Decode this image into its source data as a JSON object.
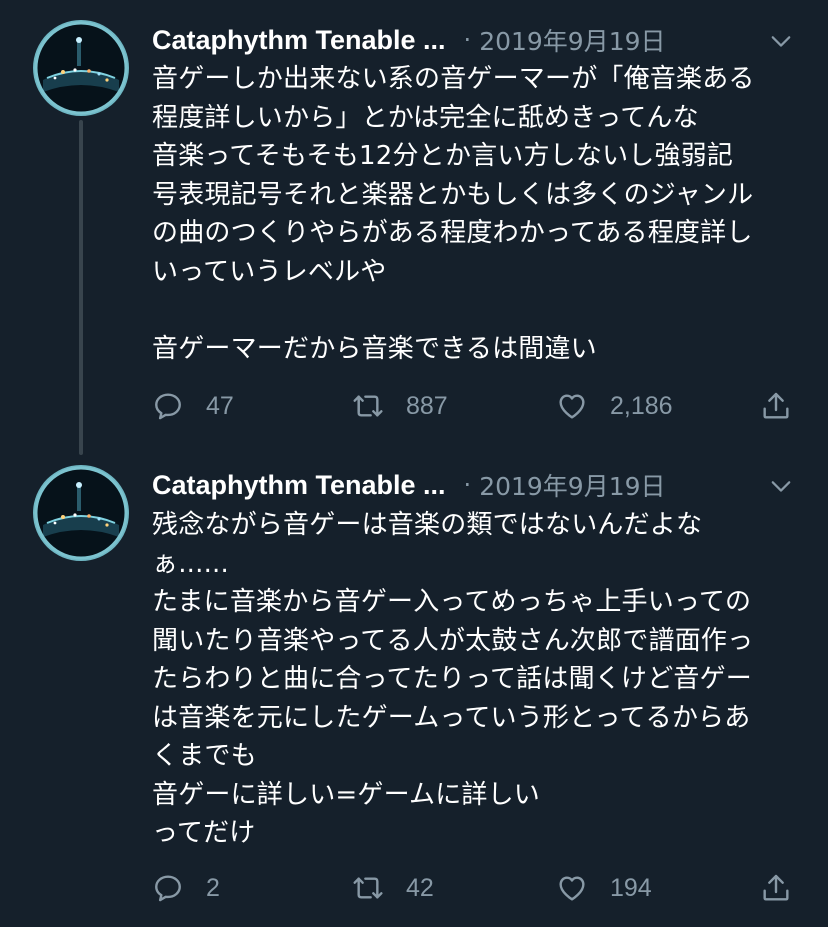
{
  "tweets": [
    {
      "author": "Cataphythm Tenable ...",
      "separator": "·",
      "date": "2019年9月19日",
      "text": "音ゲーしか出来ない系の音ゲーマーが「俺音楽ある\n程度詳しいから」とかは完全に舐めきってんな\n音楽ってそもそも12分とか言い方しないし強弱記\n号表現記号それと楽器とかもしくは多くのジャンル\nの曲のつくりやらがある程度わかってある程度詳し\nいっていうレベルや\n\n音ゲーマーだから音楽できるは間違い",
      "replies": "47",
      "retweets": "887",
      "likes": "2,186"
    },
    {
      "author": "Cataphythm Tenable ...",
      "separator": "·",
      "date": "2019年9月19日",
      "text": "残念ながら音ゲーは音楽の類ではないんだよな\nぁ......\nたまに音楽から音ゲー入ってめっちゃ上手いっての\n聞いたり音楽やってる人が太鼓さん次郎で譜面作っ\nたらわりと曲に合ってたりって話は聞くけど音ゲー\nは音楽を元にしたゲームっていう形とってるからあ\nくまでも\n音ゲーに詳しい=ゲームに詳しい\nってだけ",
      "replies": "2",
      "retweets": "42",
      "likes": "194"
    }
  ],
  "icons": {
    "reply": "reply-icon",
    "retweet": "retweet-icon",
    "like": "heart-icon",
    "share": "share-icon",
    "menu": "chevron-down-icon"
  },
  "colors": {
    "background": "#15202b",
    "text": "#ffffff",
    "secondary": "#8899a6",
    "thread_line": "#38444d"
  }
}
